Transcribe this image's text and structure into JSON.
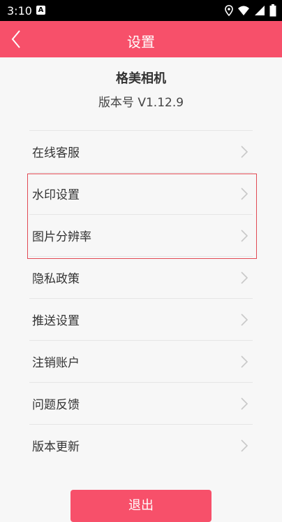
{
  "status_bar": {
    "time": "3:10",
    "badge": "A"
  },
  "header": {
    "title": "设置"
  },
  "app": {
    "name": "格美相机",
    "version": "版本号 V1.12.9"
  },
  "menu": {
    "items": [
      {
        "label": "在线客服"
      },
      {
        "label": "水印设置"
      },
      {
        "label": "图片分辨率"
      },
      {
        "label": "隐私政策"
      },
      {
        "label": "推送设置"
      },
      {
        "label": "注销账户"
      },
      {
        "label": "问题反馈"
      },
      {
        "label": "版本更新"
      }
    ]
  },
  "logout_label": "退出",
  "colors": {
    "accent": "#f7506a",
    "highlight": "#e14a54"
  }
}
